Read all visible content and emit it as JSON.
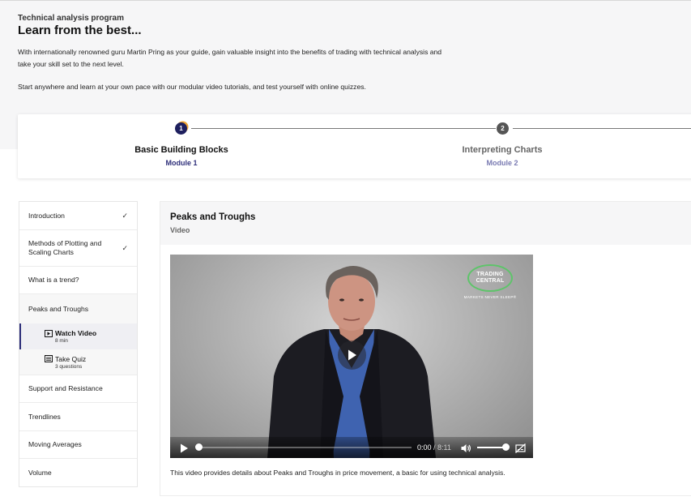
{
  "hero": {
    "eyebrow": "Technical analysis program",
    "headline": "Learn from the best...",
    "intro": "With internationally renowned guru Martin Pring as your guide, gain valuable insight into the benefits of trading with technical analysis and take your skill set to the next level.",
    "intro2": "Start anywhere and learn at your own pace with our modular video tutorials, and test yourself with online quizzes."
  },
  "stepper": {
    "steps": [
      {
        "number": "1",
        "title": "Basic Building Blocks",
        "module": "Module 1",
        "state": "active"
      },
      {
        "number": "2",
        "title": "Interpreting Charts",
        "module": "Module 2",
        "state": "inactive"
      }
    ]
  },
  "sidebar": {
    "items": [
      {
        "label": "Introduction",
        "completed": true
      },
      {
        "label": "Methods of Plotting and Scaling Charts",
        "completed": true
      },
      {
        "label": "What is a trend?",
        "completed": false
      },
      {
        "label": "Peaks and Troughs",
        "completed": false,
        "current": true
      },
      {
        "label": "Support and Resistance",
        "completed": false
      },
      {
        "label": "Trendlines",
        "completed": false
      },
      {
        "label": "Moving Averages",
        "completed": false
      },
      {
        "label": "Volume",
        "completed": false
      }
    ],
    "sub_items": [
      {
        "name": "Watch Video",
        "meta": "8 min",
        "icon": "play-square-icon",
        "selected": true
      },
      {
        "name": "Take Quiz",
        "meta": "3 questions",
        "icon": "quiz-list-icon",
        "selected": false
      }
    ],
    "check_glyph": "✓"
  },
  "lesson": {
    "title": "Peaks and Troughs",
    "type": "Video",
    "description": "This video provides details about Peaks and Troughs in price movement, a basic for using technical analysis."
  },
  "video": {
    "logo_line1": "TRADING",
    "logo_line2": "CENTRAL",
    "tagline": "MARKETS NEVER SLEEP®",
    "current_time": "0:00",
    "separator": " / ",
    "duration": "8:11",
    "progress": 0,
    "volume": 1.0
  },
  "colors": {
    "accent": "#2e2f7a",
    "active_dot": "#1e1f5e",
    "dot_highlight": "#f0a533",
    "logo_green": "#5ec46a"
  }
}
